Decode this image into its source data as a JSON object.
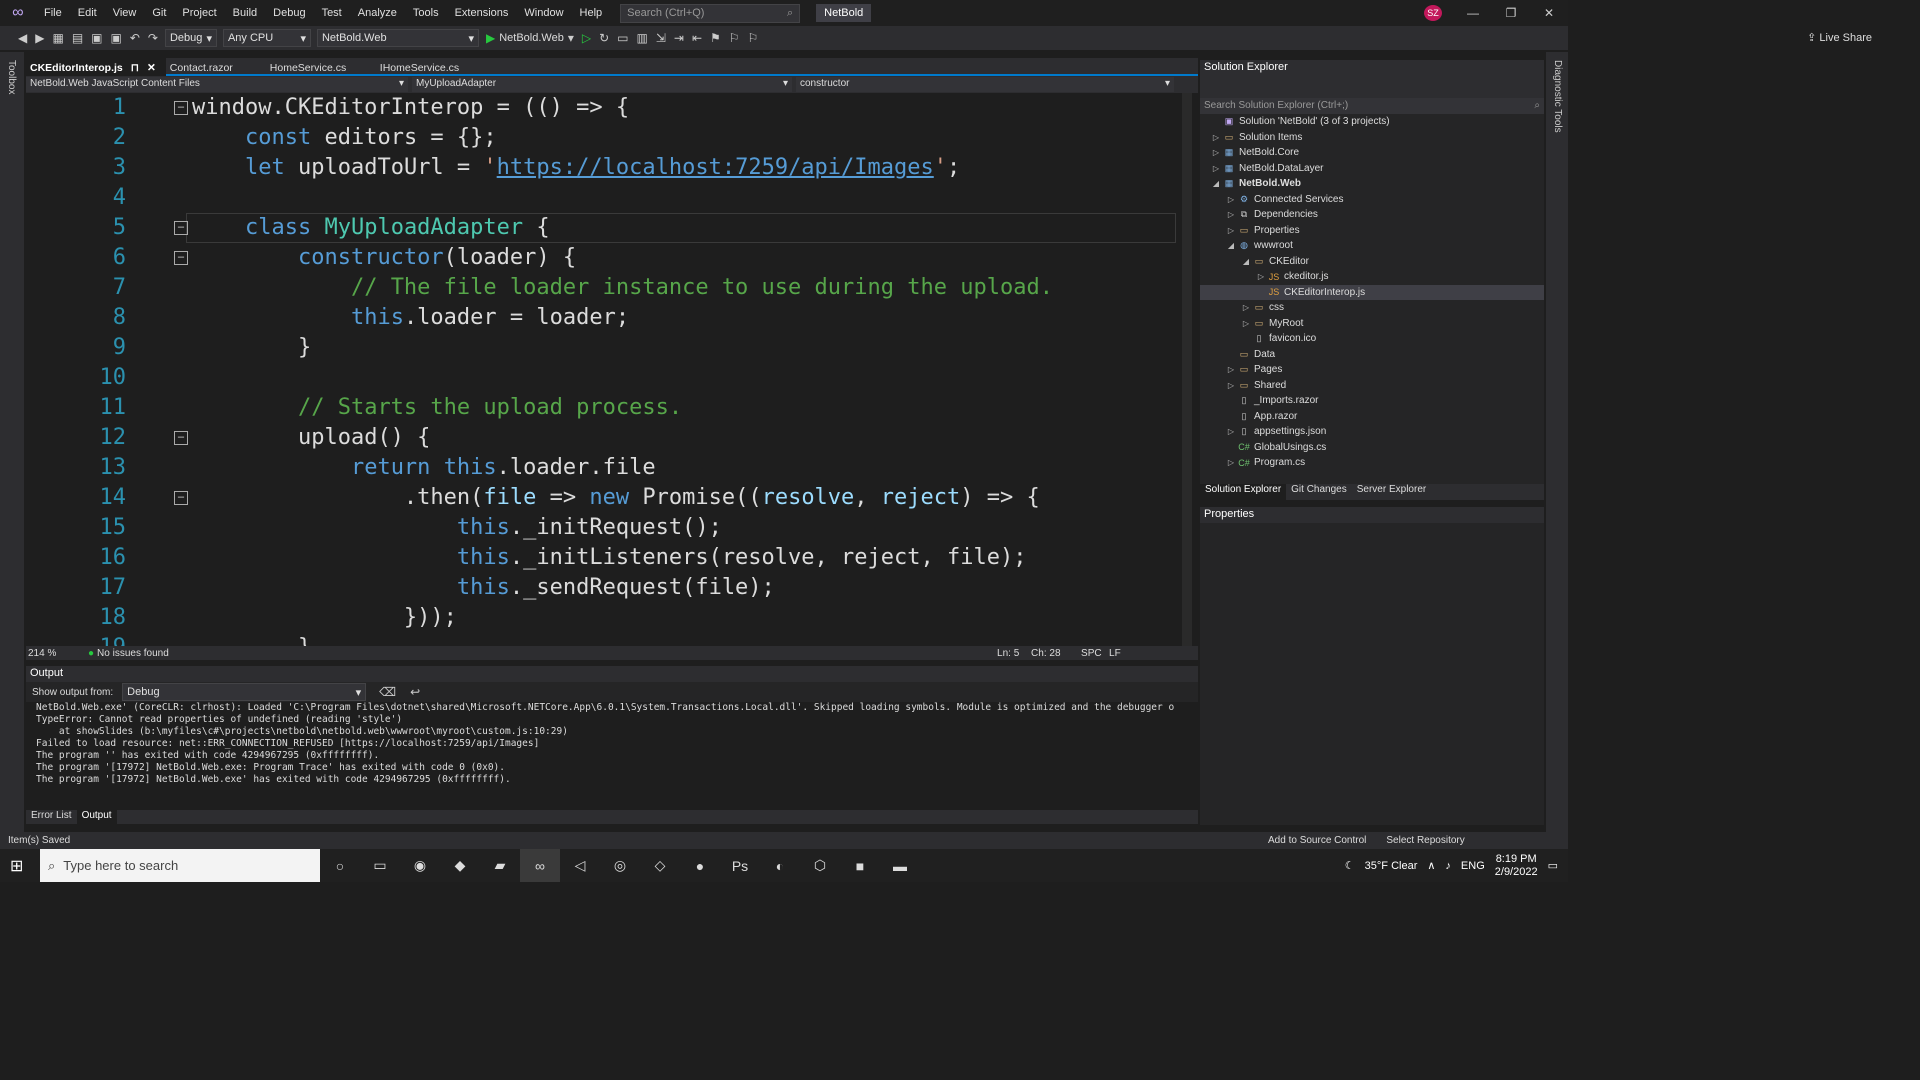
{
  "menu": {
    "items": [
      "File",
      "Edit",
      "View",
      "Git",
      "Project",
      "Build",
      "Debug",
      "Test",
      "Analyze",
      "Tools",
      "Extensions",
      "Window",
      "Help"
    ],
    "search_placeholder": "Search (Ctrl+Q)",
    "solution_name": "NetBold",
    "avatar": "SZ"
  },
  "toolbar": {
    "config": "Debug",
    "platform": "Any CPU",
    "startup": "NetBold.Web",
    "run_label": "NetBold.Web",
    "live_share": "Live Share"
  },
  "side": {
    "toolbox": "Toolbox",
    "diagnostic": "Diagnostic Tools"
  },
  "tabs": [
    {
      "label": "CKEditorInterop.js",
      "active": true
    },
    {
      "label": "Contact.razor"
    },
    {
      "label": "HomeService.cs"
    },
    {
      "label": "IHomeService.cs"
    }
  ],
  "nav": {
    "project": "NetBold.Web JavaScript Content Files",
    "scope": "MyUploadAdapter",
    "member": "constructor"
  },
  "status_editor": {
    "zoom": "214 %",
    "issues": "No issues found",
    "ln": "Ln: 5",
    "ch": "Ch: 28",
    "spc": "SPC",
    "lf": "LF"
  },
  "output": {
    "title": "Output",
    "show_from_label": "Show output from:",
    "source": "Debug",
    "lines": [
      "NetBold.Web.exe' (CoreCLR: clrhost): Loaded 'C:\\Program Files\\dotnet\\shared\\Microsoft.NETCore.App\\6.0.1\\System.Transactions.Local.dll'. Skipped loading symbols. Module is optimized and the debugger o",
      "TypeError: Cannot read properties of undefined (reading 'style')",
      "    at showSlides (b:\\myfiles\\c#\\projects\\netbold\\netbold.web\\wwwroot\\myroot\\custom.js:10:29)",
      "Failed to load resource: net::ERR_CONNECTION_REFUSED [https://localhost:7259/api/Images]",
      "The program '' has exited with code 4294967295 (0xffffffff).",
      "The program '[17972] NetBold.Web.exe: Program Trace' has exited with code 0 (0x0).",
      "The program '[17972] NetBold.Web.exe' has exited with code 4294967295 (0xffffffff)."
    ]
  },
  "bottom_tabs": [
    "Error List",
    "Output"
  ],
  "solution_explorer": {
    "title": "Solution Explorer",
    "search_placeholder": "Search Solution Explorer (Ctrl+;)",
    "items": [
      {
        "label": "Solution 'NetBold' (3 of 3 projects)",
        "depth": 0,
        "arrow": "",
        "icon": "sln"
      },
      {
        "label": "Solution Items",
        "depth": 0,
        "arrow": "▷",
        "icon": "folder"
      },
      {
        "label": "NetBold.Core",
        "depth": 0,
        "arrow": "▷",
        "icon": "proj"
      },
      {
        "label": "NetBold.DataLayer",
        "depth": 0,
        "arrow": "▷",
        "icon": "proj"
      },
      {
        "label": "NetBold.Web",
        "depth": 0,
        "arrow": "◢",
        "icon": "web",
        "bold": true
      },
      {
        "label": "Connected Services",
        "depth": 1,
        "arrow": "▷",
        "icon": "svc"
      },
      {
        "label": "Dependencies",
        "depth": 1,
        "arrow": "▷",
        "icon": "dep"
      },
      {
        "label": "Properties",
        "depth": 1,
        "arrow": "▷",
        "icon": "folder"
      },
      {
        "label": "wwwroot",
        "depth": 1,
        "arrow": "◢",
        "icon": "globe"
      },
      {
        "label": "CKEditor",
        "depth": 2,
        "arrow": "◢",
        "icon": "folder"
      },
      {
        "label": "ckeditor.js",
        "depth": 3,
        "arrow": "▷",
        "icon": "js"
      },
      {
        "label": "CKEditorInterop.js",
        "depth": 3,
        "arrow": "",
        "icon": "js",
        "selected": true
      },
      {
        "label": "css",
        "depth": 2,
        "arrow": "▷",
        "icon": "folder"
      },
      {
        "label": "MyRoot",
        "depth": 2,
        "arrow": "▷",
        "icon": "folder"
      },
      {
        "label": "favicon.ico",
        "depth": 2,
        "arrow": "",
        "icon": "file"
      },
      {
        "label": "Data",
        "depth": 1,
        "arrow": "",
        "icon": "folder"
      },
      {
        "label": "Pages",
        "depth": 1,
        "arrow": "▷",
        "icon": "folder"
      },
      {
        "label": "Shared",
        "depth": 1,
        "arrow": "▷",
        "icon": "folder"
      },
      {
        "label": "_Imports.razor",
        "depth": 1,
        "arrow": "",
        "icon": "file"
      },
      {
        "label": "App.razor",
        "depth": 1,
        "arrow": "",
        "icon": "file"
      },
      {
        "label": "appsettings.json",
        "depth": 1,
        "arrow": "▷",
        "icon": "file"
      },
      {
        "label": "GlobalUsings.cs",
        "depth": 1,
        "arrow": "",
        "icon": "cs"
      },
      {
        "label": "Program.cs",
        "depth": 1,
        "arrow": "▷",
        "icon": "cs"
      }
    ],
    "tabs": [
      "Solution Explorer",
      "Git Changes",
      "Server Explorer"
    ]
  },
  "properties": {
    "title": "Properties"
  },
  "statusbar": {
    "saved": "Item(s) Saved",
    "source_control": "Add to Source Control",
    "repo": "Select Repository"
  },
  "taskbar": {
    "search": "Type here to search",
    "weather": "35°F  Clear",
    "lang": "ENG",
    "time": "8:19 PM",
    "date": "2/9/2022"
  },
  "colors": {
    "accent": "#007acc",
    "keyword": "#569cd6",
    "class": "#4ec9b0",
    "comment": "#57a64a",
    "string": "#d69d85"
  }
}
